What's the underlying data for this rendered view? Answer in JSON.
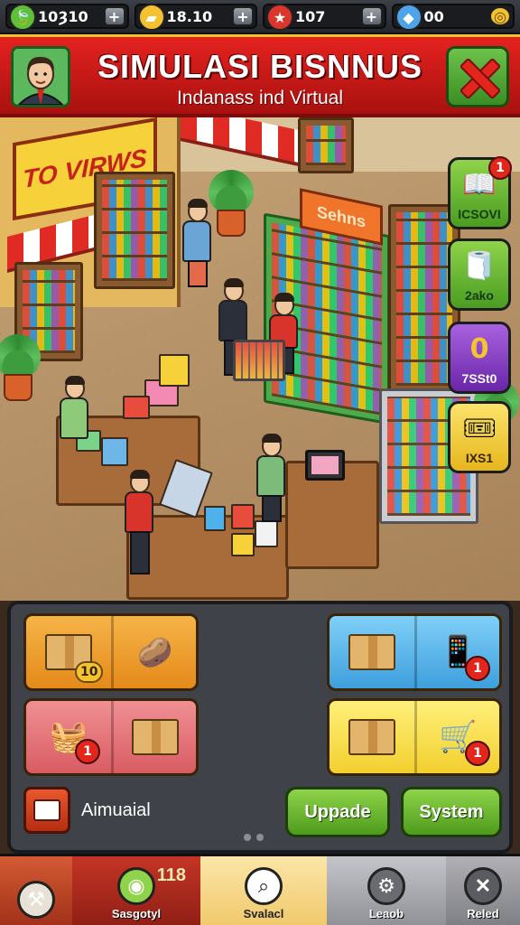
{
  "resources": [
    {
      "icon": "leaf-coin-icon",
      "value": "10Ȝ10"
    },
    {
      "icon": "gold-bar-icon",
      "value": "18.10"
    },
    {
      "icon": "medal-icon",
      "value": "107"
    },
    {
      "icon": "gem-chest-icon",
      "value": "00"
    }
  ],
  "header": {
    "title": "SIMULASI BISNNUS",
    "subtitle": "Indanass ind Virtual"
  },
  "scene": {
    "sign_left": "TO VIRWS",
    "sign_center": "Sehns"
  },
  "side_buttons": [
    {
      "label": "ICSOVI",
      "badge": "1",
      "icon": "book-icon",
      "color": "#6cc24a"
    },
    {
      "label": "2ako",
      "badge": "",
      "icon": "tissue-roll-icon",
      "color": "#6cc24a"
    },
    {
      "label": "7SSt0",
      "badge": "",
      "icon": "coin-zero-icon",
      "color": "#8b3fc9"
    },
    {
      "label": "IXS1",
      "badge": "",
      "icon": "tickets-icon",
      "color": "#f4c430"
    }
  ],
  "panel": {
    "tiles": [
      {
        "id": "restock",
        "color": "#f29b2a",
        "badge": "10"
      },
      {
        "id": "delivery",
        "color": "#4fb1ea",
        "badge": "1"
      },
      {
        "id": "storage",
        "color": "#e8747a",
        "badge": "1"
      },
      {
        "id": "shopping",
        "color": "#f7e25a",
        "badge": "1"
      }
    ],
    "manual_label": "Aimuaial",
    "upgrade_label": "Uppade",
    "system_label": "System"
  },
  "nav": {
    "tabs": [
      {
        "label": "",
        "icon": "build-icon",
        "badge": "",
        "bg": "#b63d23"
      },
      {
        "label": "Sasgotyl",
        "icon": "coin-icon",
        "badge": "118",
        "bg": "#a8261d"
      },
      {
        "label": "Svalacl",
        "icon": "search-icon",
        "badge": "",
        "bg": "#f7d68a"
      },
      {
        "label": "Leaob",
        "icon": "gear-icon",
        "badge": "",
        "bg": "#a7a8ad"
      },
      {
        "label": "Reled",
        "icon": "close-icon",
        "badge": "",
        "bg": "#8f8f94"
      }
    ]
  }
}
